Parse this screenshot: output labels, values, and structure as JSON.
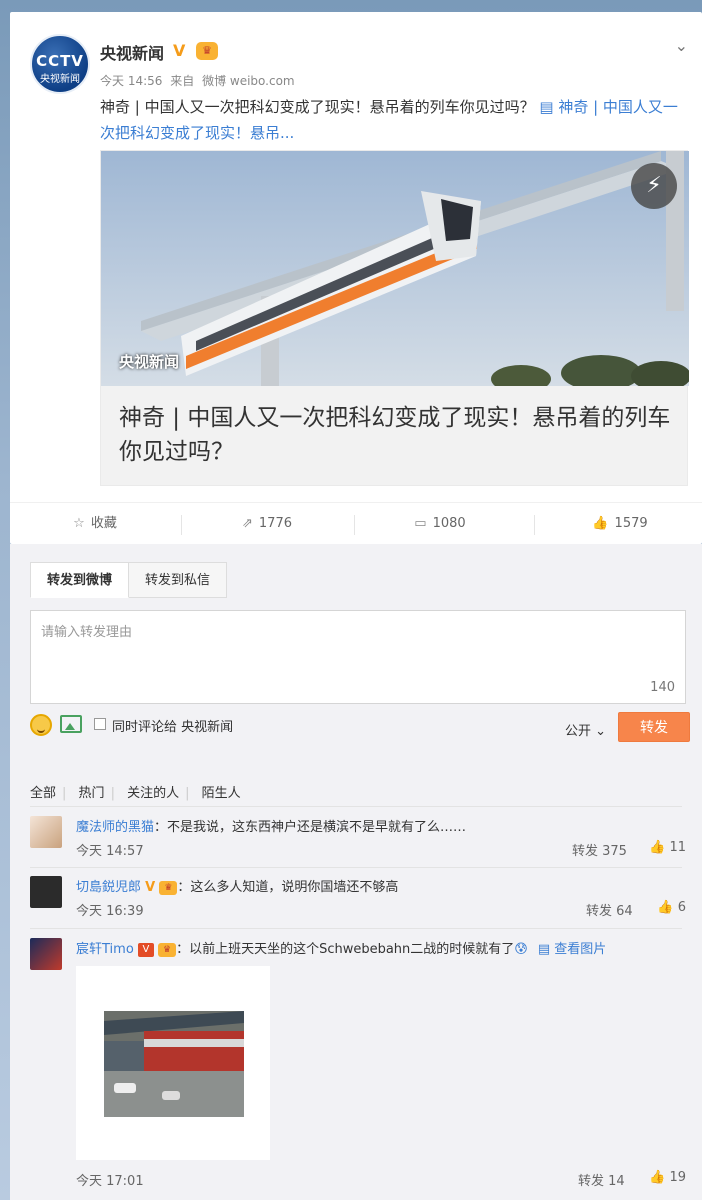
{
  "post": {
    "author": "央视新闻",
    "verified_badge": "V",
    "avatar_top": "CCTV",
    "avatar_bottom": "央视新闻",
    "time": "今天 14:56",
    "source_prefix": "来自",
    "source": "微博 weibo.com",
    "text": "神奇 | 中国人又一次把科幻变成了现实！悬吊着的列车你见过吗？",
    "link_text": "神奇 | 中国人又一次把科幻变成了现实！悬吊...",
    "media_watermark": "央视新闻",
    "media_title": "神奇 | 中国人又一次把科幻变成了现实！悬吊着的列车你见过吗？",
    "actions": {
      "favorite": "收藏",
      "repost_count": "1776",
      "comment_count": "1080",
      "like_count": "1579"
    }
  },
  "repost": {
    "tab_weibo": "转发到微博",
    "tab_message": "转发到私信",
    "placeholder": "请输入转发理由",
    "counter": "140",
    "also_comment": "同时评论给 央视新闻",
    "visibility": "公开",
    "submit": "转发"
  },
  "filters": [
    "全部",
    "热门",
    "关注的人",
    "陌生人"
  ],
  "comments": [
    {
      "name": "魔法师的黑猫",
      "text": "：不是我说，这东西神户还是横滨不是早就有了么……",
      "time": "今天 14:57",
      "repost": "转发 375",
      "likes": "11"
    },
    {
      "name": "切島鋭児郎",
      "text": "：这么多人知道，说明你国墙还不够高",
      "time": "今天 16:39",
      "repost": "转发 64",
      "likes": "6"
    },
    {
      "name": "宸轩Timo",
      "text": "：以前上班天天坐的这个Schwebebahn二战的时候就有了",
      "see_image": "查看图片",
      "time": "今天 17:01",
      "repost": "转发 14",
      "likes": "19"
    }
  ]
}
